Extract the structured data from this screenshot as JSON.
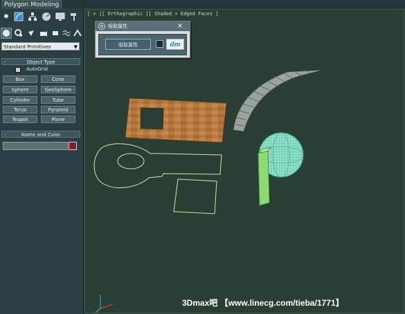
{
  "ribbon": {
    "tab_label": "Polygon Modeling"
  },
  "command_panel": {
    "dropdown_value": "Standard Primitives",
    "object_type": {
      "header": "Object Type",
      "sign": "-",
      "autogrid_label": "AutoGrid",
      "buttons": [
        "Box",
        "Cone",
        "Sphere",
        "GeoSphere",
        "Cylinder",
        "Tube",
        "Torus",
        "Pyramid",
        "Teapot",
        "Plane"
      ]
    },
    "name_and_color": {
      "header": "Name and Color",
      "sign": "-",
      "swatch_color": "#8a1e2f"
    }
  },
  "viewport": {
    "label": "[ + ][ Orthographic ][ Shaded + Edged Faces ]"
  },
  "dialog": {
    "title": "吸取属性",
    "button_label": "吸取属性",
    "close_glyph": "×",
    "logo_text": "dm"
  },
  "watermark": "3Dmax吧 【www.linecg.com/tieba/1771】",
  "colors": {
    "viewport_bg": "#2b3e35",
    "panel_bg": "#2a3e44",
    "wood": "#b8793f",
    "shape_line": "#d7e7a6",
    "sphere": "#6be3cf",
    "box_green": "#93e07a"
  }
}
